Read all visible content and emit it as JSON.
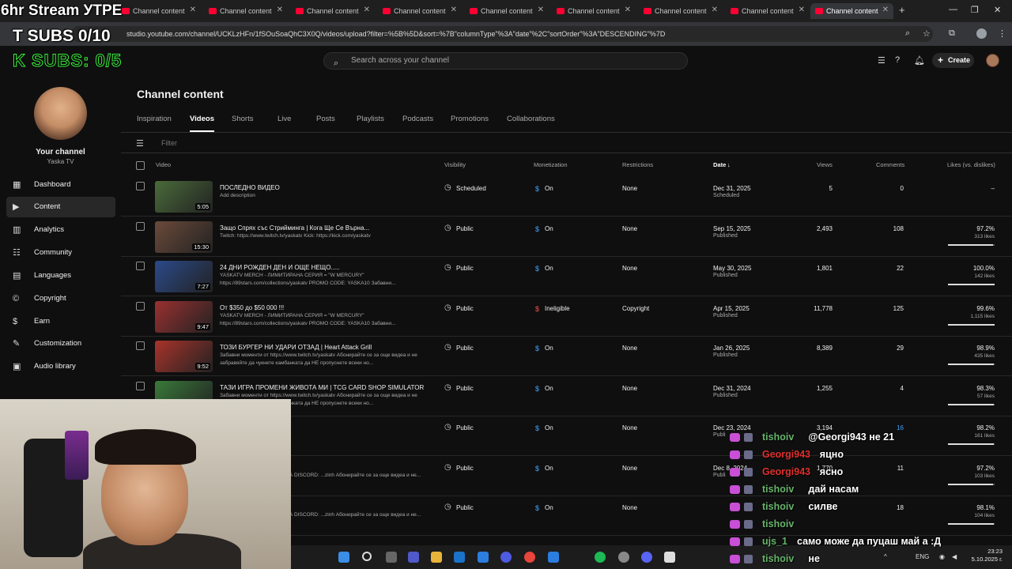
{
  "browser": {
    "tab_label": "Channel content",
    "url": "studio.youtube.com/channel/UCKLzHFn/1fSOuSoaQhC3X0Q/videos/upload?filter=%5B%5D&sort=%7B\"columnType\"%3A\"date\"%2C\"sortOrder\"%3A\"DESCENDING\"%7D"
  },
  "header": {
    "search_placeholder": "Search across your channel",
    "create_label": "Create"
  },
  "sidebar": {
    "channel_label": "Your channel",
    "channel_handle": "Yaska TV",
    "items": [
      {
        "label": "Dashboard",
        "icon": "dashboard-icon"
      },
      {
        "label": "Content",
        "icon": "content-icon"
      },
      {
        "label": "Analytics",
        "icon": "analytics-icon"
      },
      {
        "label": "Community",
        "icon": "community-icon"
      },
      {
        "label": "Languages",
        "icon": "languages-icon"
      },
      {
        "label": "Copyright",
        "icon": "copyright-icon"
      },
      {
        "label": "Earn",
        "icon": "earn-icon"
      },
      {
        "label": "Customization",
        "icon": "customization-icon"
      },
      {
        "label": "Audio library",
        "icon": "audio-library-icon"
      }
    ]
  },
  "main": {
    "title": "Channel content",
    "tabs": [
      "Inspiration",
      "Videos",
      "Shorts",
      "Live",
      "Posts",
      "Playlists",
      "Podcasts",
      "Promotions",
      "Collaborations"
    ],
    "filter_placeholder": "Filter",
    "columns": {
      "video": "Video",
      "visibility": "Visibility",
      "monetization": "Monetization",
      "restrictions": "Restrictions",
      "date": "Date",
      "views": "Views",
      "comments": "Comments",
      "likes": "Likes (vs. dislikes)"
    },
    "rows": [
      {
        "title": "ПОСЛЕДНО ВИДЕО",
        "desc": "Add description",
        "duration": "5:05",
        "visibility": "Scheduled",
        "monetization": "On",
        "restrictions": "None",
        "date": "Dec 31, 2025",
        "status": "Scheduled",
        "views": "5",
        "comments": "0",
        "likes": "–",
        "likes_sub": "",
        "thumb_color": "#4a6b3a"
      },
      {
        "title": "Защо Спрях със Стрийминга | Кога Ще Се Върна...",
        "desc": "Twitch: https://www.twitch.tv/yaskatv Kick: https://kick.com/yaskatv",
        "duration": "15:30",
        "visibility": "Public",
        "monetization": "On",
        "restrictions": "None",
        "date": "Sep 15, 2025",
        "status": "Published",
        "views": "2,493",
        "comments": "108",
        "likes": "97.2%",
        "likes_sub": "313 likes",
        "likes_pct": 0.972,
        "thumb_color": "#6b4a3a"
      },
      {
        "title": "24 ДНИ РОЖДЕН ДЕН И ОЩЕ НЕЩО.....",
        "desc": "YASKATV MERCH - ЛИМИТИРАНА СЕРИЯ = \"W MERCURY\" https://89stars.com/collections/yaskatv PROMO CODE: YASKA10 Забавни...",
        "duration": "7:27",
        "visibility": "Public",
        "monetization": "On",
        "restrictions": "None",
        "date": "May 30, 2025",
        "status": "Published",
        "views": "1,801",
        "comments": "22",
        "likes": "100.0%",
        "likes_sub": "142 likes",
        "likes_pct": 1.0,
        "thumb_color": "#2b4a8a"
      },
      {
        "title": "От $350 до $50 000 !!!",
        "desc": "YASKATV MERCH - ЛИМИТИРАНА СЕРИЯ = \"W MERCURY\" https://89stars.com/collections/yaskatv PROMO CODE: YASKA10 Забавни...",
        "duration": "9:47",
        "visibility": "Public",
        "monetization": "Ineligible",
        "restrictions": "Copyright",
        "date": "Apr 15, 2025",
        "status": "Published",
        "views": "11,778",
        "comments": "125",
        "likes": "99.6%",
        "likes_sub": "1,115 likes",
        "likes_pct": 0.996,
        "thumb_color": "#9a3030"
      },
      {
        "title": "ТОЗИ БУРГЕР НИ УДАРИ ОТЗАД | Heart Attack Grill",
        "desc": "Забавни моменти от https://www.twitch.tv/yaskatv Абонирайте се за още видеа и не забравяйте да чукнете камбанката да НЕ пропуснете всеки но...",
        "duration": "9:52",
        "visibility": "Public",
        "monetization": "On",
        "restrictions": "None",
        "date": "Jan 26, 2025",
        "status": "Published",
        "views": "8,389",
        "comments": "29",
        "likes": "98.9%",
        "likes_sub": "435 likes",
        "likes_pct": 0.989,
        "thumb_color": "#a8332a"
      },
      {
        "title": "ТАЗИ ИГРА ПРОМЕНИ ЖИВОТА МИ | TCG CARD SHOP SIMULATOR",
        "desc": "Забавни моменти от https://www.twitch.tv/yaskatv Абонирайте се за още видеа и не забравяйте да чукнете камбанката да НЕ пропуснете всеки но...",
        "duration": "",
        "visibility": "Public",
        "monetization": "On",
        "restrictions": "None",
        "date": "Dec 31, 2024",
        "status": "Published",
        "views": "1,255",
        "comments": "4",
        "likes": "98.3%",
        "likes_sub": "57 likes",
        "likes_pct": 0.983,
        "thumb_color": "#3a7a3a"
      },
      {
        "title": "",
        "desc": "",
        "duration": "",
        "visibility": "Public",
        "monetization": "On",
        "restrictions": "None",
        "date": "Dec 23, 2024",
        "status": "Publi",
        "views": "3,194",
        "comments": "16",
        "likes": "98.2%",
        "likes_sub": "161 likes",
        "likes_pct": 0.982,
        "thumb_color": ""
      },
      {
        "title": "",
        "desc": "w.twitch.tv/yaskatv ПОКАНА ЗА DISCORD: ...zinh Абонирайте се за още видеа и не...",
        "duration": "",
        "visibility": "Public",
        "monetization": "On",
        "restrictions": "None",
        "date": "Dec 8, 2024",
        "status": "Publi",
        "views": "1,770",
        "comments": "11",
        "likes": "97.2%",
        "likes_sub": "103 likes",
        "likes_pct": 0.972,
        "thumb_color": ""
      },
      {
        "title": "",
        "desc": "w.twitch.tv/yaskatv ПОКАНА ЗА DISCORD: ...zinh Абонирайте се за още видеа и не...",
        "duration": "",
        "visibility": "Public",
        "monetization": "On",
        "restrictions": "None",
        "date": "",
        "status": "",
        "views": "",
        "comments": "18",
        "likes": "98.1%",
        "likes_sub": "104 likes",
        "likes_pct": 0.981,
        "thumb_color": ""
      }
    ]
  },
  "overlay": {
    "stream_title": "6hr Stream УТРЕ",
    "subs_line1": "T SUBS 0/10",
    "subs_line2": "K SUBS: 0/5"
  },
  "chat": [
    {
      "user": "tishoiv",
      "text": "@Georgi943 не 21",
      "color": "#66b36a"
    },
    {
      "user": "Georgi943",
      "text": "яцно",
      "color": "#e0302e"
    },
    {
      "user": "Georgi943",
      "text": "ясно",
      "color": "#e0302e"
    },
    {
      "user": "tishoiv",
      "text": "дай насам",
      "color": "#66b36a"
    },
    {
      "user": "tishoiv",
      "text": "силве",
      "color": "#66b36a"
    },
    {
      "user": "tishoiv",
      "text": "",
      "color": "#66b36a"
    },
    {
      "user": "ujs_1",
      "text": "само може да пуцаш май а :Д",
      "color": "#66b36a"
    },
    {
      "user": "tishoiv",
      "text": "не",
      "color": "#66b36a"
    }
  ],
  "taskbar": {
    "lang": "ENG",
    "time": "23:23",
    "date": "5.10.2025 г."
  }
}
